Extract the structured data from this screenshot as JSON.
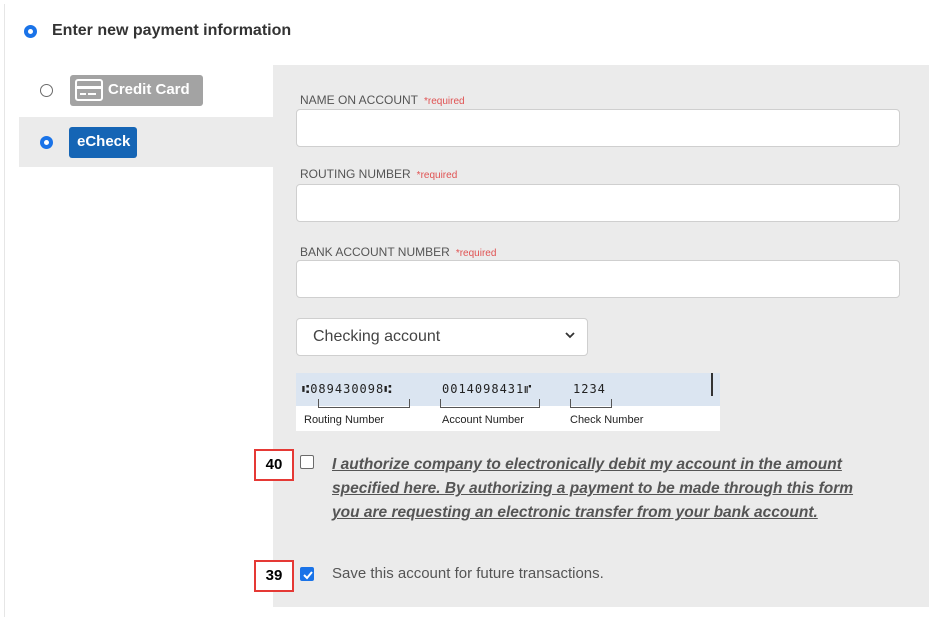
{
  "header": {
    "title": "Enter new payment information"
  },
  "methods": {
    "credit_card": {
      "label": "Credit Card",
      "selected": false
    },
    "echeck": {
      "label": "eCheck",
      "selected": true
    }
  },
  "form": {
    "name_on_account": {
      "label": "NAME ON ACCOUNT",
      "required": "*required",
      "value": ""
    },
    "routing_number": {
      "label": "ROUTING NUMBER",
      "required": "*required",
      "value": ""
    },
    "bank_account_number": {
      "label": "BANK ACCOUNT NUMBER",
      "required": "*required",
      "value": ""
    },
    "account_type": {
      "selected": "Checking account"
    }
  },
  "check_example": {
    "micr_routing": "⑆089430098⑆",
    "micr_account": "0014098431⑈",
    "micr_check": "1234",
    "routing_caption": "Routing Number",
    "account_caption": "Account Number",
    "check_caption": "Check Number"
  },
  "authorize": {
    "marker": "40",
    "checked": false,
    "text": "I authorize company to electronically debit my account in the amount specified here. By authorizing a payment to be made through this form you are requesting an electronic transfer from your bank account."
  },
  "save_account": {
    "marker": "39",
    "checked": true,
    "text": "Save this account for future transactions."
  },
  "colors": {
    "accent": "#1a73e8",
    "echeck_badge": "#1565b5",
    "cc_badge": "#a3a3a3",
    "required": "#e05252",
    "marker_border": "#e53935"
  }
}
